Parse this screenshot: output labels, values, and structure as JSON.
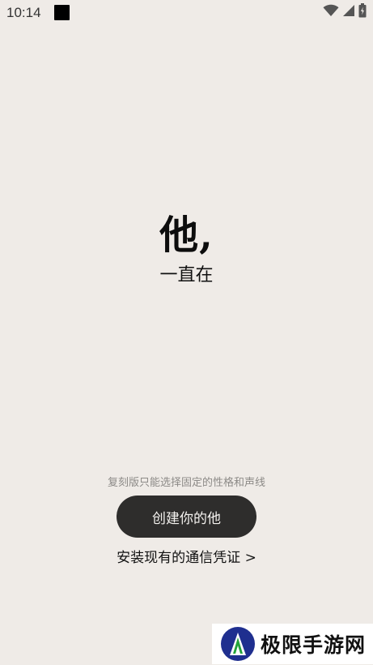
{
  "status_bar": {
    "time": "10:14",
    "icons": [
      "notification-square-icon",
      "wifi-icon",
      "signal-icon",
      "battery-icon"
    ]
  },
  "hero": {
    "title": "他,",
    "subtitle": "一直在"
  },
  "footer": {
    "hint": "复刻版只能选择固定的性格和声线",
    "create_button_label": "创建你的他",
    "install_link_label": "安装现有的通信凭证 >"
  },
  "watermark": {
    "text": "极限手游网",
    "logo_icon": "jixian-logo-icon"
  },
  "colors": {
    "background": "#efebe7",
    "button_bg": "#2e2d2c",
    "button_text": "#f4f2ef",
    "hint_text": "#8c8a87",
    "logo_blue": "#1f2f8f",
    "logo_green": "#22a33a"
  }
}
